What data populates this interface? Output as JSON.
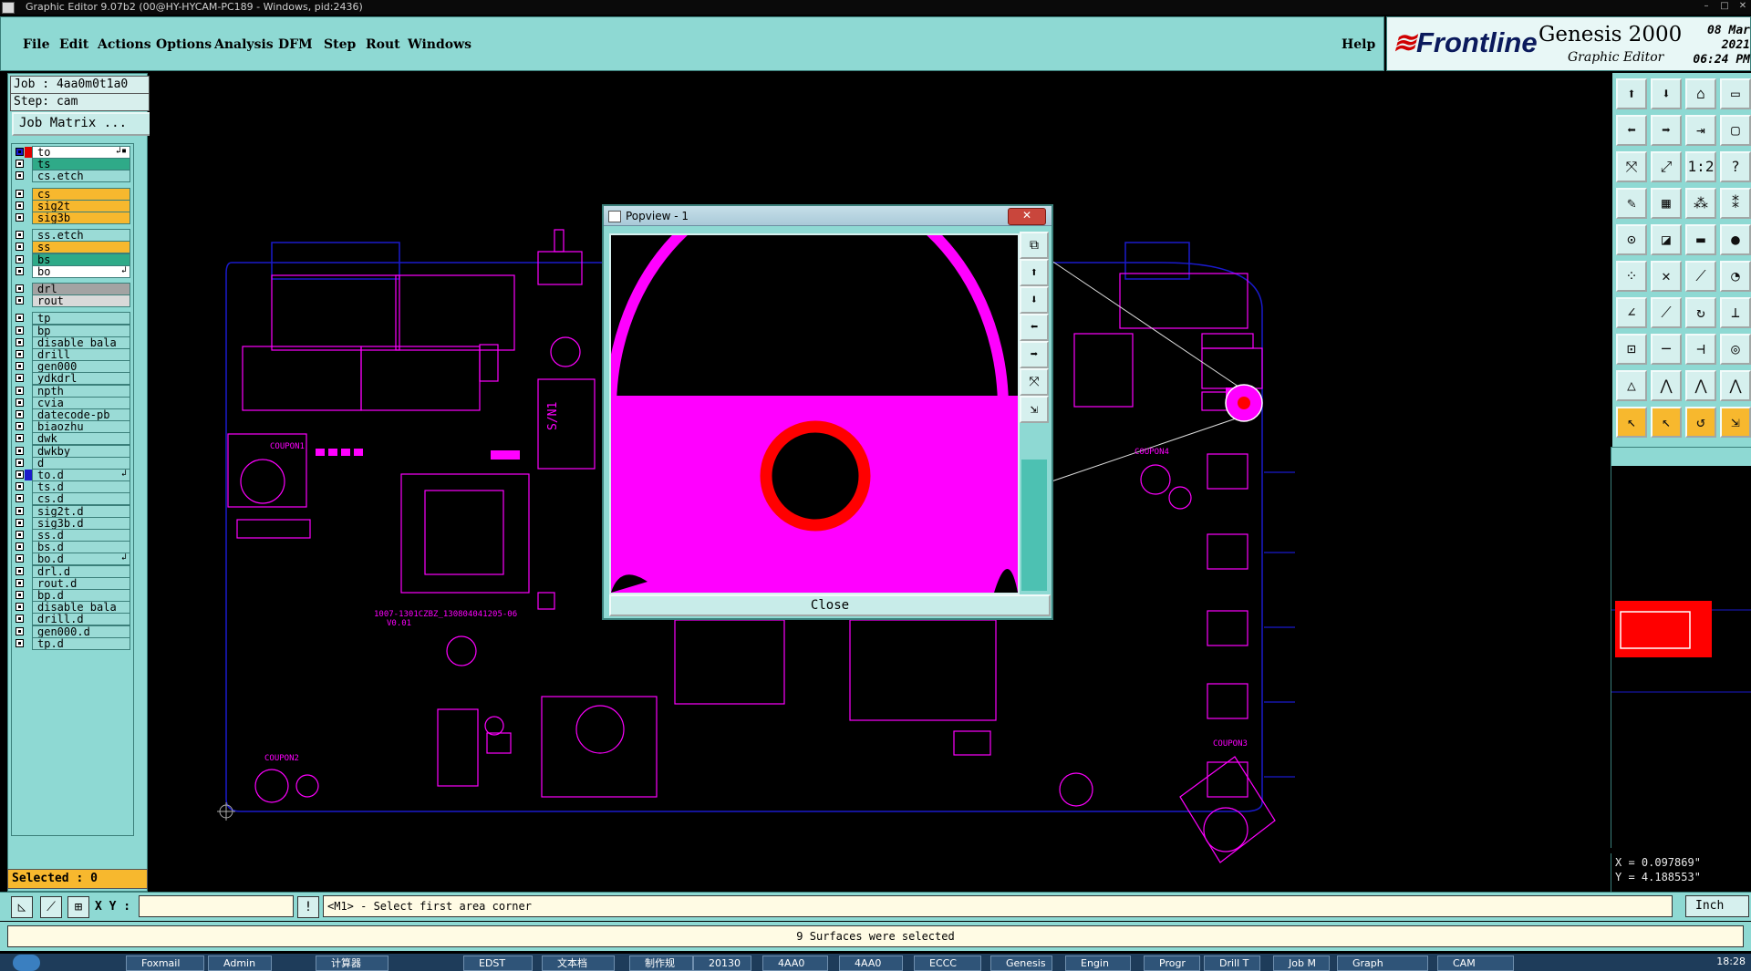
{
  "window": {
    "title": "Graphic Editor 9.07b2 (00@HY-HYCAM-PC189 - Windows, pid:2436)"
  },
  "menu": {
    "items": [
      "File",
      "Edit",
      "Actions",
      "Options",
      "Analysis",
      "DFM",
      "Step",
      "Rout",
      "Windows"
    ],
    "help": "Help"
  },
  "brand": {
    "logo": "Frontline",
    "product": "Genesis 2000",
    "subtitle": "Graphic Editor",
    "date": "08 Mar 2021",
    "time": "06:24 PM"
  },
  "job": {
    "job_label": "Job : 4aa0m0t1a0",
    "step_label": "Step: cam",
    "matrix_button": "Job Matrix ..."
  },
  "layers": [
    {
      "name": "to",
      "bg": "#ffffff",
      "mark": "↲▪"
    },
    {
      "name": "ts",
      "bg": "#2faa88",
      "mark": ""
    },
    {
      "name": "cs.etch",
      "bg": "#9adbd6",
      "mark": ""
    },
    {
      "name": "cs",
      "bg": "#f7b82e",
      "mark": ""
    },
    {
      "name": "sig2t",
      "bg": "#f7b82e",
      "mark": ""
    },
    {
      "name": "sig3b",
      "bg": "#f7b82e",
      "mark": ""
    },
    {
      "name": "ss.etch",
      "bg": "#9adbd6",
      "mark": ""
    },
    {
      "name": "ss",
      "bg": "#f7b82e",
      "mark": ""
    },
    {
      "name": "bs",
      "bg": "#2faa88",
      "mark": ""
    },
    {
      "name": "bo",
      "bg": "#ffffff",
      "mark": "↲"
    },
    {
      "name": "drl",
      "bg": "#a3a3a3",
      "mark": ""
    },
    {
      "name": "rout",
      "bg": "#d9d9d9",
      "mark": ""
    },
    {
      "name": "tp",
      "bg": "#9adbd6",
      "mark": ""
    },
    {
      "name": "bp",
      "bg": "#9adbd6",
      "mark": ""
    },
    {
      "name": "disable_bala",
      "bg": "#9adbd6",
      "mark": ""
    },
    {
      "name": "drill",
      "bg": "#9adbd6",
      "mark": ""
    },
    {
      "name": "gen000",
      "bg": "#9adbd6",
      "mark": ""
    },
    {
      "name": "ydkdrl",
      "bg": "#9adbd6",
      "mark": ""
    },
    {
      "name": "npth",
      "bg": "#9adbd6",
      "mark": ""
    },
    {
      "name": "cvia",
      "bg": "#9adbd6",
      "mark": ""
    },
    {
      "name": "datecode-pb",
      "bg": "#9adbd6",
      "mark": ""
    },
    {
      "name": "biaozhu",
      "bg": "#9adbd6",
      "mark": ""
    },
    {
      "name": "dwk",
      "bg": "#9adbd6",
      "mark": ""
    },
    {
      "name": "dwkby",
      "bg": "#9adbd6",
      "mark": ""
    },
    {
      "name": "d",
      "bg": "#9adbd6",
      "mark": ""
    },
    {
      "name": "to.d",
      "bg": "#9adbd6",
      "mark": "↲"
    },
    {
      "name": "ts.d",
      "bg": "#9adbd6",
      "mark": ""
    },
    {
      "name": "cs.d",
      "bg": "#9adbd6",
      "mark": ""
    },
    {
      "name": "sig2t.d",
      "bg": "#9adbd6",
      "mark": ""
    },
    {
      "name": "sig3b.d",
      "bg": "#9adbd6",
      "mark": ""
    },
    {
      "name": "ss.d",
      "bg": "#9adbd6",
      "mark": ""
    },
    {
      "name": "bs.d",
      "bg": "#9adbd6",
      "mark": ""
    },
    {
      "name": "bo.d",
      "bg": "#9adbd6",
      "mark": "↲"
    },
    {
      "name": "drl.d",
      "bg": "#9adbd6",
      "mark": ""
    },
    {
      "name": "rout.d",
      "bg": "#9adbd6",
      "mark": ""
    },
    {
      "name": "bp.d",
      "bg": "#9adbd6",
      "mark": ""
    },
    {
      "name": "disable_bala",
      "bg": "#9adbd6",
      "mark": ""
    },
    {
      "name": "drill.d",
      "bg": "#9adbd6",
      "mark": ""
    },
    {
      "name": "gen000.d",
      "bg": "#9adbd6",
      "mark": ""
    },
    {
      "name": "tp.d",
      "bg": "#9adbd6",
      "mark": ""
    }
  ],
  "selected_label": "Selected : 0",
  "coords": {
    "x": "X = 0.097869\"",
    "y": "Y = 4.188553\""
  },
  "command": {
    "xy_label": "X Y :",
    "xy_value": "",
    "prompt": "<M1> - Select first area corner",
    "units": "Inch"
  },
  "status": "9 Surfaces were selected",
  "popview": {
    "title": "Popview - 1",
    "close_label": "Close"
  },
  "board_labels": {
    "sn": "S/N1",
    "code": "1007-1301CZBZ_130804041205-06",
    "version": "V0.01",
    "coupon1": "COUPON1",
    "coupon2": "COUPON2",
    "coupon3": "COUPON3",
    "coupon4": "COUPON4"
  },
  "taskbar": {
    "items": [
      "Foxmail",
      "Admin",
      "计算器",
      "EDST",
      "文本档",
      "制作规",
      "20130",
      "4AA0",
      "4AA0",
      "ECCC",
      "Genesis",
      "Engin",
      "Progr",
      "Drill T",
      "Job M",
      "Graph",
      "CAM"
    ],
    "clock": "18:28"
  },
  "colors": {
    "teal": "#8ed9d3",
    "orange": "#f7b82e",
    "magenta": "#ff00ff",
    "outline": "#1a1acc",
    "red": "#ff0000"
  }
}
